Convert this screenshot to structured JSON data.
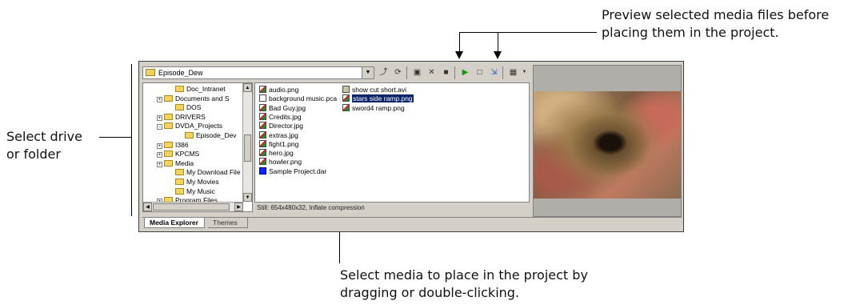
{
  "callouts": {
    "preview_line1": "Preview selected media files before",
    "preview_line2": "placing them in the project.",
    "select_folder_line1": "Select drive",
    "select_folder_line2": "or folder",
    "select_media_line1": "Select media to place in the project by",
    "select_media_line2": "dragging or double-clicking."
  },
  "explorer": {
    "path": "Episode_Dew",
    "tree_items": [
      {
        "label": "Doc_Intranet",
        "expander": ""
      },
      {
        "label": "Documents and S",
        "expander": "+"
      },
      {
        "label": "DOS",
        "expander": ""
      },
      {
        "label": "DRIVERS",
        "expander": "+"
      },
      {
        "label": "DVDA_Projects",
        "expander": "−"
      },
      {
        "label": "Episode_Dev",
        "expander": ""
      },
      {
        "label": "I386",
        "expander": "+"
      },
      {
        "label": "KPCMS",
        "expander": "+"
      },
      {
        "label": "Media",
        "expander": "+"
      },
      {
        "label": "My Download File",
        "expander": ""
      },
      {
        "label": "My Movies",
        "expander": ""
      },
      {
        "label": "My Music",
        "expander": ""
      },
      {
        "label": "Program Files",
        "expander": "+"
      }
    ],
    "files_col1": [
      {
        "name": "audio.png",
        "icon": "image-file-icon"
      },
      {
        "name": "background music.pca",
        "icon": "audio-file-icon"
      },
      {
        "name": "Bad Guy.jpg",
        "icon": "image-file-icon"
      },
      {
        "name": "Credits.jpg",
        "icon": "image-file-icon"
      },
      {
        "name": "Director.jpg",
        "icon": "image-file-icon"
      },
      {
        "name": "extras.jpg",
        "icon": "image-file-icon"
      },
      {
        "name": "fight1.png",
        "icon": "image-file-icon"
      },
      {
        "name": "hero.jpg",
        "icon": "image-file-icon"
      },
      {
        "name": "howler.png",
        "icon": "image-file-icon"
      },
      {
        "name": "Sample Project.dar",
        "icon": "project-file-icon"
      }
    ],
    "files_col2": [
      {
        "name": "show cut short.avi",
        "icon": "video-file-icon"
      },
      {
        "name": "stars side ramp.png",
        "icon": "image-file-icon",
        "selected": true
      },
      {
        "name": "sword4 ramp.png",
        "icon": "image-file-icon"
      }
    ],
    "status": "Still: 654x480x32, Inflate compression",
    "tabs": {
      "media_explorer": "Media Explorer",
      "themes": "Themes"
    }
  },
  "toolbar_icons": [
    "up-folder-icon",
    "refresh-icon",
    "new-folder-icon",
    "delete-icon",
    "properties-icon",
    "play-icon",
    "stop-icon",
    "auto-preview-icon",
    "views-icon"
  ]
}
